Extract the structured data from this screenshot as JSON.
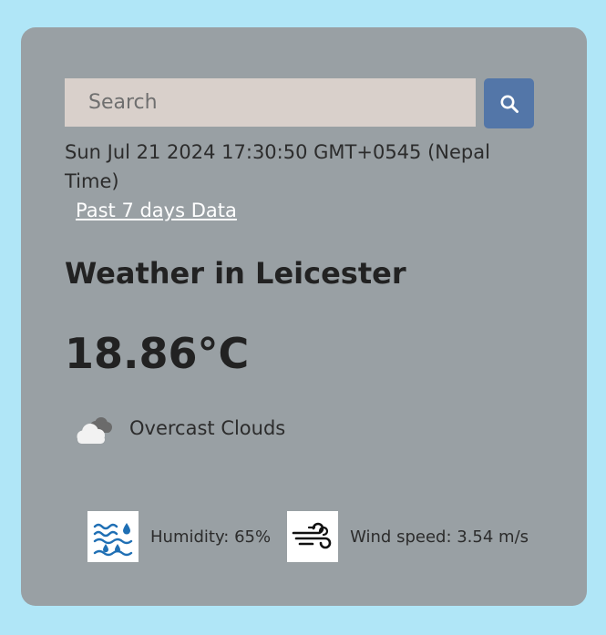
{
  "search": {
    "placeholder": "Search",
    "button_icon": "search-icon"
  },
  "datetime": "Sun Jul 21 2024 17:30:50 GMT+0545 (Nepal Time)",
  "past_link": "Past 7 days Data",
  "city_heading": "Weather in Leicester",
  "temperature": "18.86°C",
  "condition": {
    "icon": "overcast-clouds-icon",
    "label": "Overcast Clouds"
  },
  "humidity": {
    "icon": "humidity-icon",
    "label": "Humidity: 65%"
  },
  "wind": {
    "icon": "wind-icon",
    "label": "Wind speed: 3.54 m/s"
  },
  "colors": {
    "page_background": "#b0e6f7",
    "card_background": "#99a0a4",
    "search_field": "#d9d0cb",
    "search_button": "#5376a8",
    "link": "#ffffff",
    "icon_blue": "#1f6fb4"
  }
}
